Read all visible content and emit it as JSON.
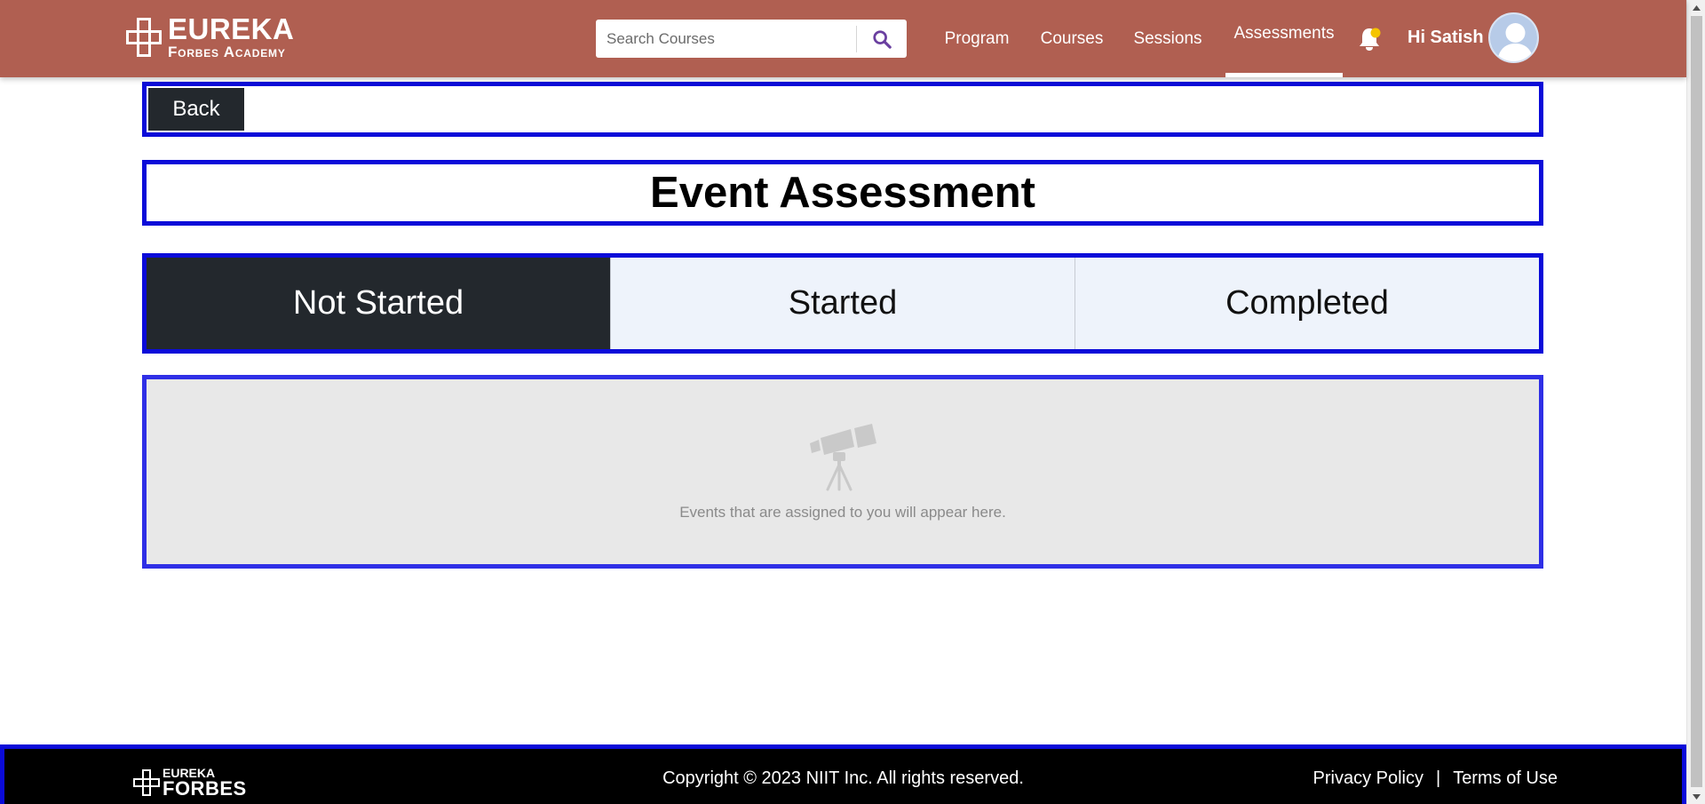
{
  "header": {
    "logo_top": "EUREKA",
    "logo_bottom": "Forbes Academy",
    "search_placeholder": "Search Courses",
    "nav": [
      {
        "label": "Program"
      },
      {
        "label": "Courses"
      },
      {
        "label": "Sessions"
      },
      {
        "label": "Assessments",
        "active": true
      }
    ],
    "greeting": "Hi Satish",
    "brand_color": "#b05f51"
  },
  "back_button": "Back",
  "page_title": "Event Assessment",
  "tabs": [
    {
      "label": "Not Started",
      "active": true
    },
    {
      "label": "Started"
    },
    {
      "label": "Completed"
    }
  ],
  "empty_state": {
    "icon": "telescope-icon",
    "message": "Events that are assigned to you will appear here."
  },
  "footer": {
    "logo_top": "EUREKA",
    "logo_bottom": "FORBES",
    "copyright": "Copyright © 2023 NIIT Inc. All rights reserved.",
    "privacy": "Privacy Policy",
    "separator": "|",
    "terms": "Terms of Use"
  }
}
